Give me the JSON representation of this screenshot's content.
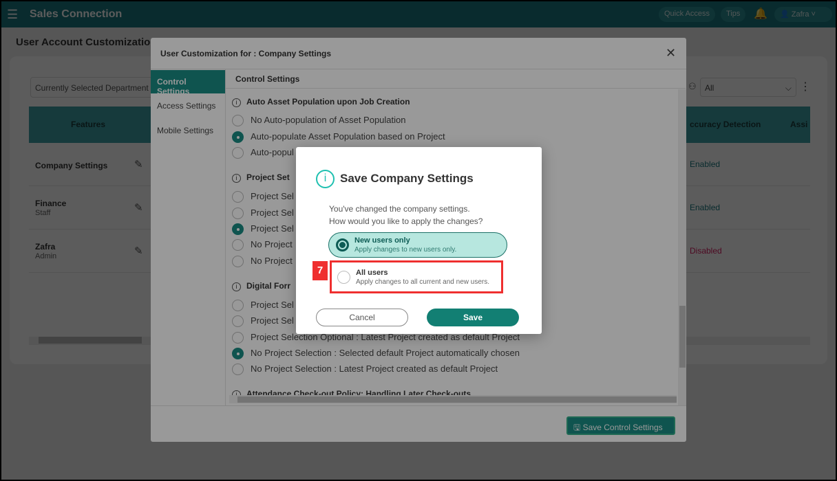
{
  "header": {
    "app_title": "Sales Connection",
    "quick_access": "Quick Access",
    "tips": "Tips",
    "user": "Zafra"
  },
  "page": {
    "title": "User Account Customization",
    "department_placeholder": "Currently Selected Department",
    "filter_value": "All",
    "columns": [
      "Features",
      "ccuracy Detection",
      "Assi"
    ],
    "rows": [
      {
        "name": "Company Settings",
        "sub": "",
        "value": "Enabled"
      },
      {
        "name": "Finance",
        "sub": "Staff",
        "value": "Enabled"
      },
      {
        "name": "Zafra",
        "sub": "Admin",
        "value": "Disabled"
      }
    ]
  },
  "colors": {
    "enabled": "#1a7a80",
    "disabled": "#d81b60",
    "accent": "#1a8d84"
  },
  "modal": {
    "title": "User Customization for : Company Settings",
    "nav": [
      "Control Settings",
      "Access Settings",
      "Mobile Settings"
    ],
    "content_title": "Control Settings",
    "sections": [
      {
        "title": "Auto Asset Population upon Job Creation",
        "options": [
          {
            "label": "No Auto-population of Asset Population",
            "checked": false
          },
          {
            "label": "Auto-populate Asset Population based on Project",
            "checked": true
          },
          {
            "label": "Auto-popul",
            "checked": false
          }
        ]
      },
      {
        "title": "Project Set",
        "options": [
          {
            "label": "Project Sel",
            "checked": false
          },
          {
            "label": "Project Sel",
            "checked": false
          },
          {
            "label": "Project Sel",
            "checked": true
          },
          {
            "label": "No Project",
            "checked": false
          },
          {
            "label": "No Project",
            "checked": false
          }
        ]
      },
      {
        "title": "Digital Forr",
        "options": [
          {
            "label": "Project Sel",
            "checked": false
          },
          {
            "label": "Project Sel",
            "checked": false
          },
          {
            "label": "Project Selection Optional : Latest Project created as default Project",
            "checked": false
          },
          {
            "label": "No Project Selection : Selected default Project automatically chosen",
            "checked": true
          },
          {
            "label": "No Project Selection : Latest Project created as default Project",
            "checked": false
          }
        ]
      },
      {
        "title": "Attendance Check-out Policy: Handling Later Check-outs",
        "options": []
      }
    ],
    "save_button": "Save Control Settings"
  },
  "dialog": {
    "title": "Save Company Settings",
    "message_line1": "You've changed the company settings.",
    "message_line2": "How would you like to apply the changes?",
    "options": [
      {
        "label": "New users only",
        "sub": "Apply changes to new users only.",
        "selected": true
      },
      {
        "label": "All users",
        "sub": "Apply changes to all current and new users.",
        "selected": false
      }
    ],
    "cancel": "Cancel",
    "save": "Save",
    "annotation": "7"
  }
}
